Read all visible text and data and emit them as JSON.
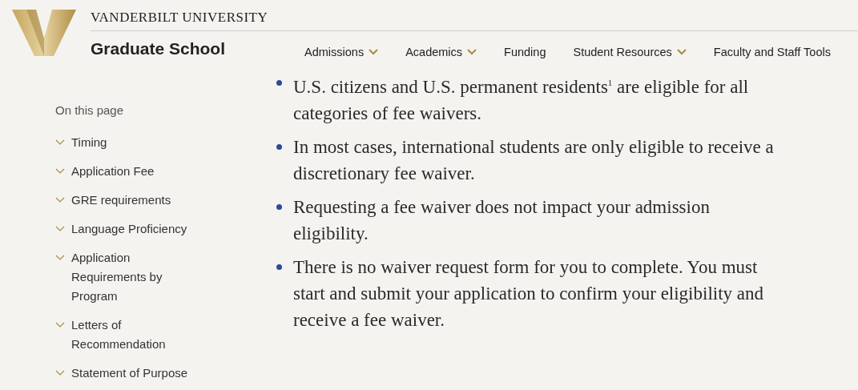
{
  "header": {
    "university": "VANDERBILT UNIVERSITY",
    "site_title": "Graduate School",
    "nav": [
      {
        "label": "Admissions",
        "dropdown": true
      },
      {
        "label": "Academics",
        "dropdown": true
      },
      {
        "label": "Funding",
        "dropdown": false
      },
      {
        "label": "Student Resources",
        "dropdown": true
      },
      {
        "label": "Faculty and Staff Tools",
        "dropdown": false
      }
    ]
  },
  "sidebar": {
    "title": "On this page",
    "items": [
      "Timing",
      "Application Fee",
      "GRE requirements",
      "Language Proficiency",
      "Application Requirements by Program",
      "Letters of Recommendation",
      "Statement of Purpose"
    ]
  },
  "content": {
    "bullets": [
      "U.S. citizens and U.S. permanent residents$^{1}$ are eligible for all categories of fee waivers.",
      "In most cases, international students are only eligible to receive a discretionary fee waiver.",
      "Requesting a fee waiver does not impact your admission eligibility.",
      "There is no waiver request form for you to complete. You must start and submit your application to confirm your eligibility and receive a fee waiver."
    ]
  }
}
